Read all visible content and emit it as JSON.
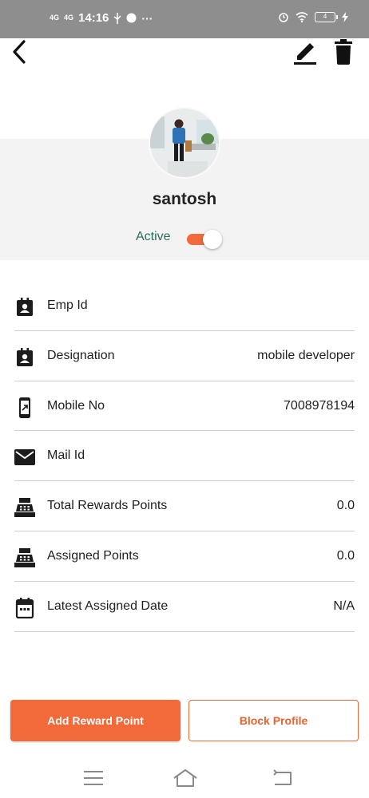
{
  "status_bar": {
    "network_1": "4G",
    "network_2": "4G",
    "time": "14:16",
    "more": "···",
    "battery": "4"
  },
  "profile": {
    "name": "santosh",
    "status_label": "Active",
    "active": true
  },
  "details": [
    {
      "icon": "contact-card-icon",
      "label": "Emp Id",
      "value": ""
    },
    {
      "icon": "contact-card-icon",
      "label": "Designation",
      "value": "mobile developer"
    },
    {
      "icon": "phone-icon",
      "label": "Mobile No",
      "value": "7008978194"
    },
    {
      "icon": "mail-icon",
      "label": "Mail Id",
      "value": ""
    },
    {
      "icon": "cash-register-icon",
      "label": "Total Rewards Points",
      "value": "0.0"
    },
    {
      "icon": "cash-register-icon",
      "label": "Assigned Points",
      "value": "0.0"
    },
    {
      "icon": "calendar-icon",
      "label": "Latest Assigned Date",
      "value": "N/A"
    }
  ],
  "actions": {
    "add_reward": "Add Reward Point",
    "block_profile": "Block Profile"
  },
  "colors": {
    "accent": "#f2693a",
    "active_text": "#2d6c5d",
    "band": "#f3f3f3"
  }
}
